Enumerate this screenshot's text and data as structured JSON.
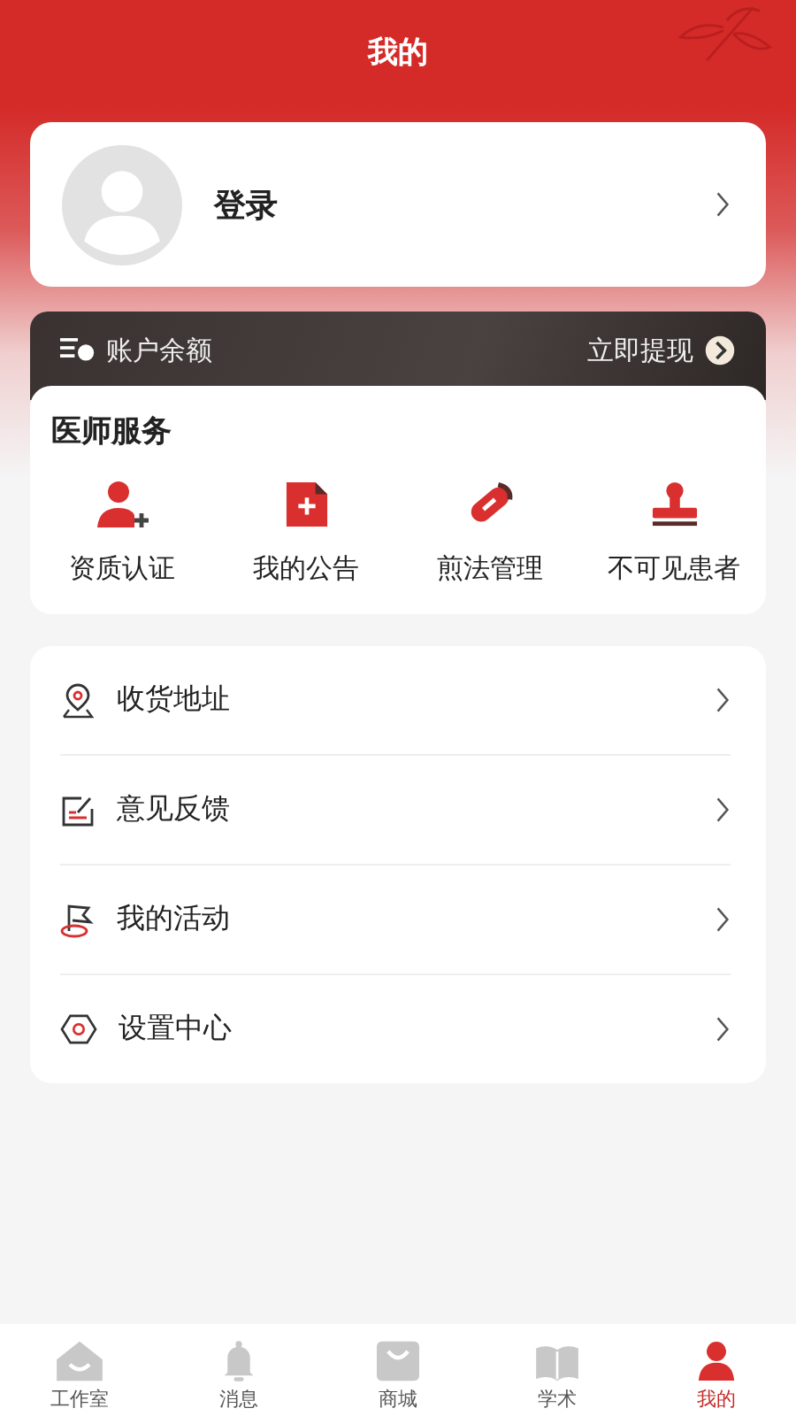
{
  "header": {
    "title": "我的"
  },
  "login": {
    "label": "登录"
  },
  "balance": {
    "label": "账户余额",
    "action": "立即提现"
  },
  "services": {
    "title": "医师服务",
    "items": [
      {
        "label": "资质认证",
        "kind": "person-add"
      },
      {
        "label": "我的公告",
        "kind": "document"
      },
      {
        "label": "煎法管理",
        "kind": "pill"
      },
      {
        "label": "不可见患者",
        "kind": "stamp"
      }
    ]
  },
  "menu": [
    {
      "label": "收货地址",
      "kind": "location"
    },
    {
      "label": "意见反馈",
      "kind": "feedback"
    },
    {
      "label": "我的活动",
      "kind": "flag"
    },
    {
      "label": "设置中心",
      "kind": "settings"
    }
  ],
  "tabs": [
    {
      "label": "工作室",
      "kind": "home",
      "selected": false
    },
    {
      "label": "消息",
      "kind": "bell",
      "selected": false
    },
    {
      "label": "商城",
      "kind": "bag",
      "selected": false
    },
    {
      "label": "学术",
      "kind": "book",
      "selected": false
    },
    {
      "label": "我的",
      "kind": "person",
      "selected": true
    }
  ]
}
